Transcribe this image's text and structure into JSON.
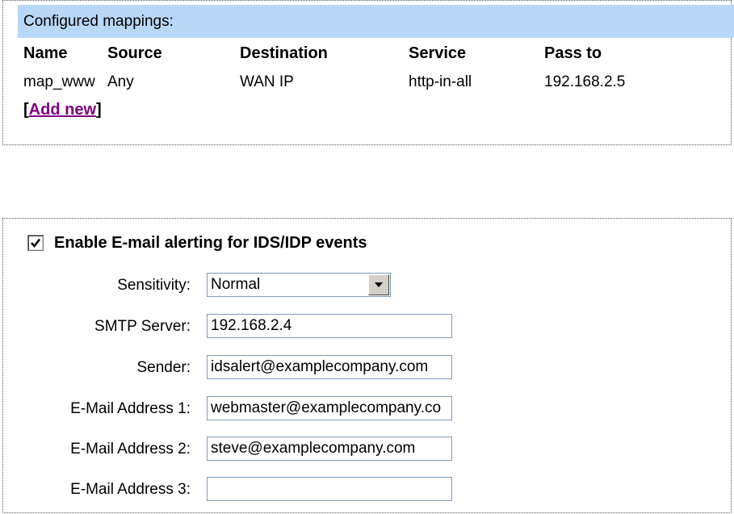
{
  "mappings": {
    "header": "Configured mappings:",
    "columns": [
      "Name",
      "Source",
      "Destination",
      "Service",
      "Pass to"
    ],
    "rows": [
      [
        "map_www",
        "Any",
        "WAN IP",
        "http-in-all",
        "192.168.2.5"
      ]
    ],
    "add_new_label": "Add new"
  },
  "alerting": {
    "enable_label": "Enable E-mail alerting for IDS/IDP events",
    "enabled": true,
    "sensitivity": {
      "label": "Sensitivity:",
      "value": "Normal"
    },
    "smtp_server": {
      "label": "SMTP Server:",
      "value": "192.168.2.4"
    },
    "sender": {
      "label": "Sender:",
      "value": "idsalert@examplecompany.com"
    },
    "email1": {
      "label": "E-Mail Address 1:",
      "value": "webmaster@examplecompany.co"
    },
    "email2": {
      "label": "E-Mail Address 2:",
      "value": "steve@examplecompany.com"
    },
    "email3": {
      "label": "E-Mail Address 3:",
      "value": ""
    }
  }
}
